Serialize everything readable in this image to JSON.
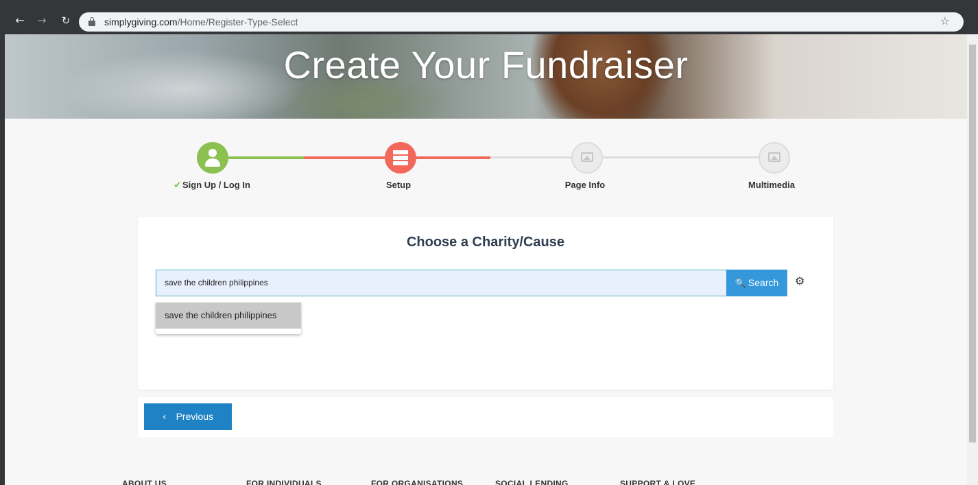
{
  "browser": {
    "url_domain": "simplygiving.com",
    "url_path": "/Home/Register-Type-Select"
  },
  "hero": {
    "title": "Create Your Fundraiser"
  },
  "steps": [
    {
      "label": "Sign Up / Log In",
      "state": "complete",
      "icon": "user-icon",
      "color": "#8cc152"
    },
    {
      "label": "Setup",
      "state": "active",
      "icon": "server-icon",
      "color": "#f2685a"
    },
    {
      "label": "Page Info",
      "state": "pending",
      "icon": "image-icon"
    },
    {
      "label": "Multimedia",
      "state": "pending",
      "icon": "image-icon"
    }
  ],
  "charity": {
    "title": "Choose a Charity/Cause",
    "search_value": "save the children philippines",
    "search_button": "Search",
    "suggestions": [
      "save the children philippines"
    ]
  },
  "navigation": {
    "previous_label": "Previous"
  },
  "footer": {
    "links": [
      "ABOUT US",
      "FOR INDIVIDUALS",
      "FOR ORGANISATIONS",
      "SOCIAL LENDING",
      "SUPPORT & LOVE"
    ]
  },
  "colors": {
    "accent_blue": "#3498db",
    "button_blue": "#1e82c4",
    "green": "#8cc152",
    "red": "#f2685a"
  }
}
